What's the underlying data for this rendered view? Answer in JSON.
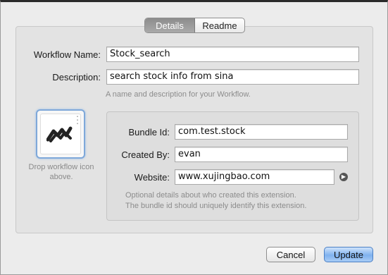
{
  "tabs": [
    {
      "label": "Details",
      "active": true
    },
    {
      "label": "Readme",
      "active": false
    }
  ],
  "form": {
    "workflow_name_label": "Workflow Name:",
    "workflow_name_value": "Stock_search",
    "description_label": "Description:",
    "description_value": "search stock info from sina",
    "name_hint": "A name and description for your Workflow."
  },
  "icon_well": {
    "icon": "alfred-workflow-icon",
    "drop_text": "Drop workflow icon above."
  },
  "details": {
    "bundle_id_label": "Bundle Id:",
    "bundle_id_value": "com.test.stock",
    "created_by_label": "Created By:",
    "created_by_value": "evan",
    "website_label": "Website:",
    "website_value": "www.xujingbao.com",
    "hint_line1": "Optional details about who created this extension.",
    "hint_line2": "The bundle id should uniquely identify this extension."
  },
  "buttons": {
    "cancel": "Cancel",
    "update": "Update"
  },
  "colors": {
    "accent": "#7fb2ef",
    "focus_ring": "#7fa8d9",
    "window_bg": "#ececec"
  }
}
